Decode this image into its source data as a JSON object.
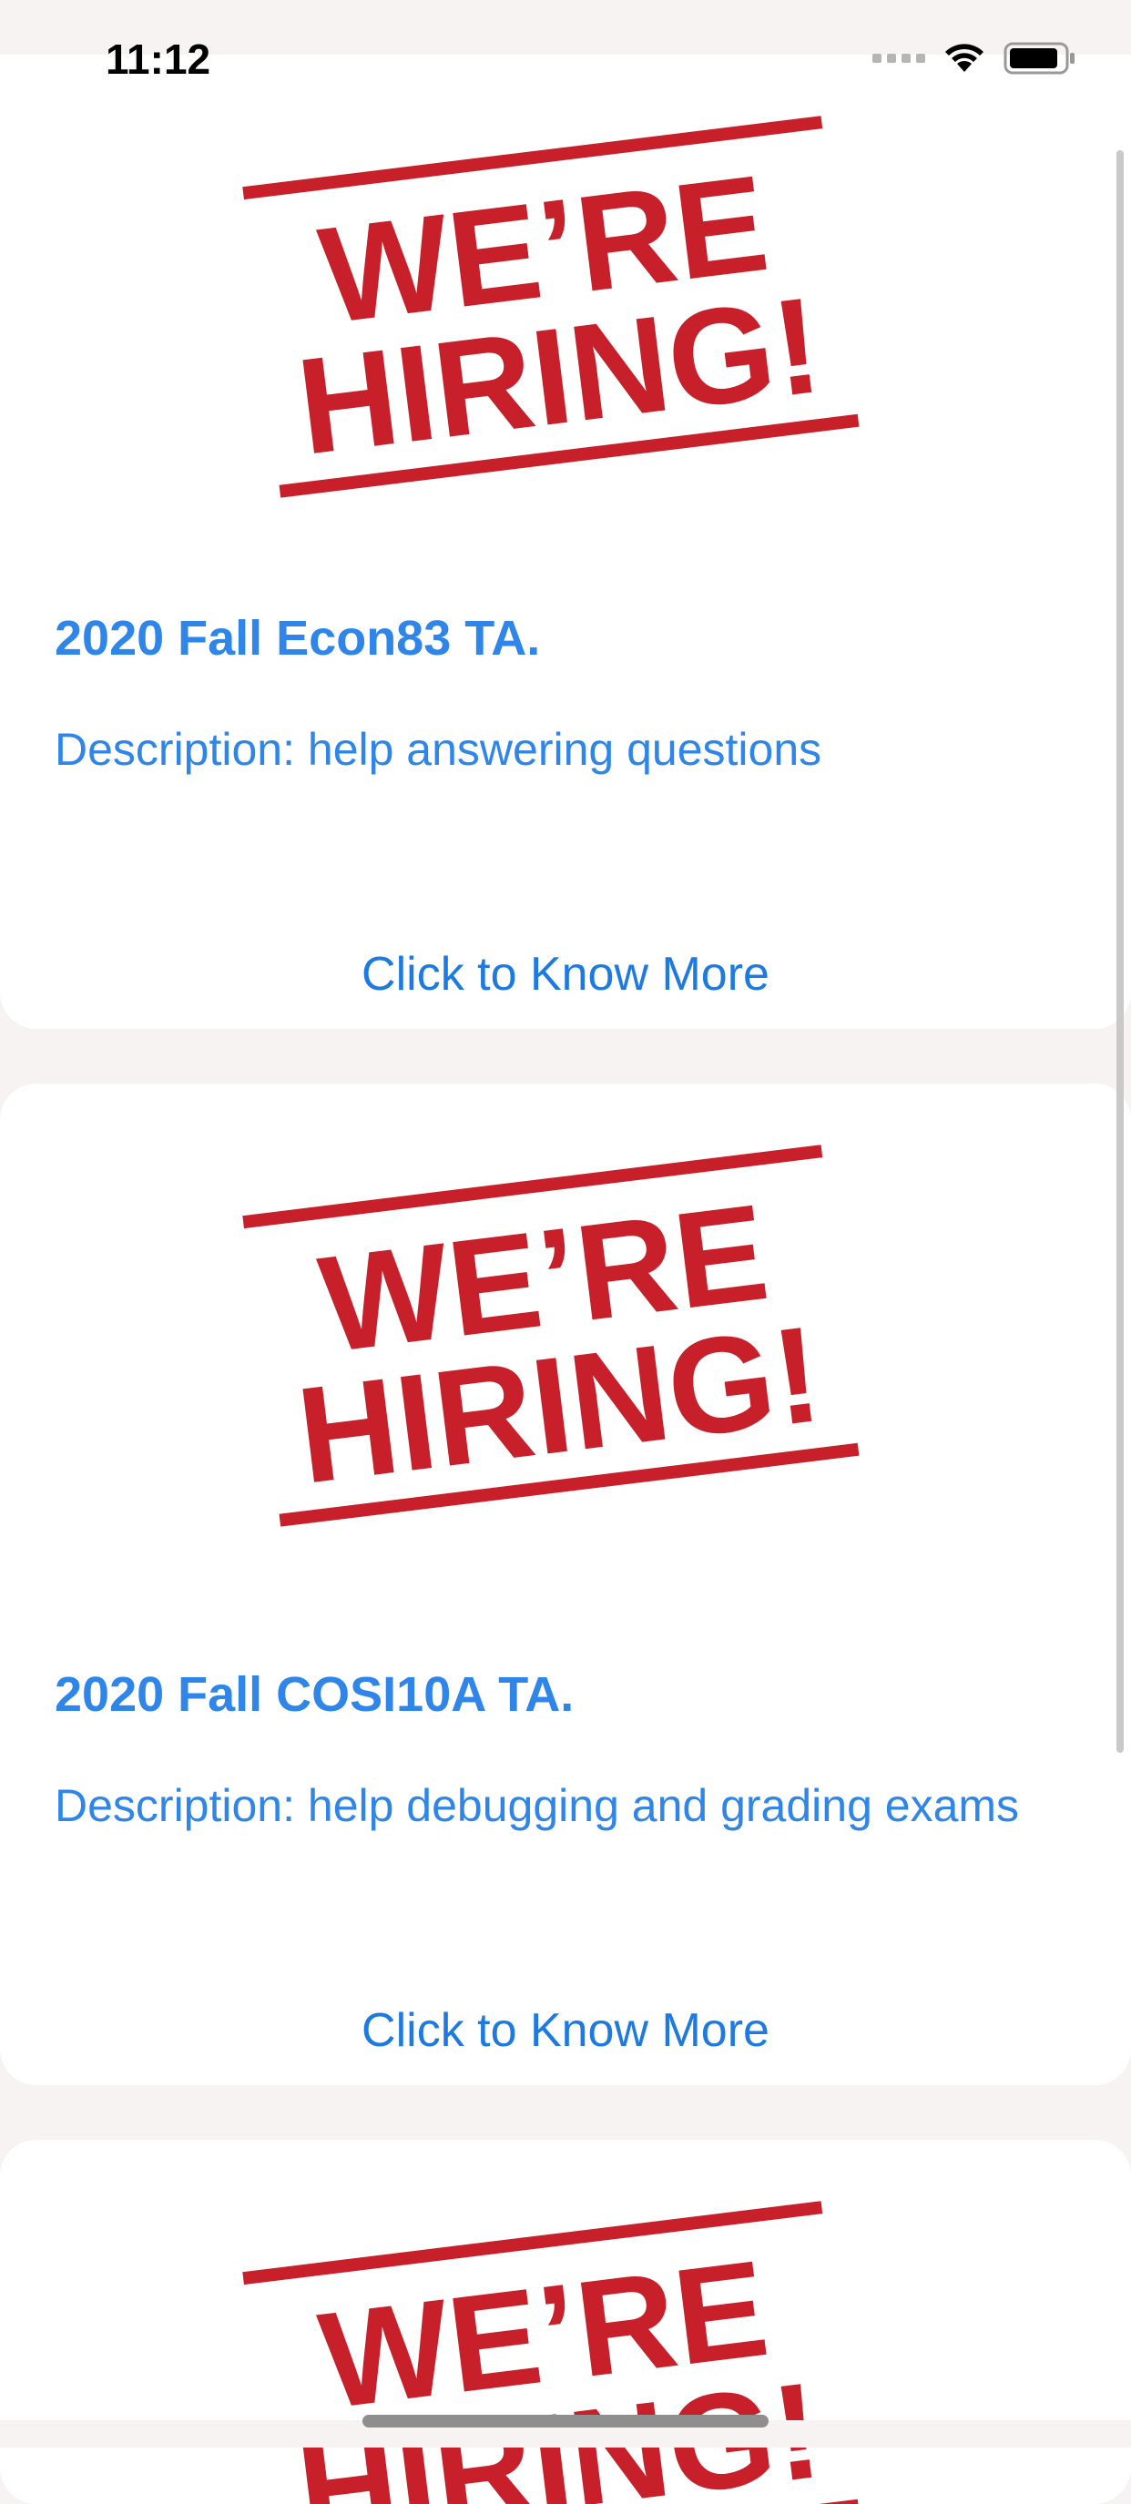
{
  "status_bar": {
    "time": "11:12"
  },
  "jobs": [
    {
      "image_icon": "hiring-stamp-image",
      "stamp_line_1": "WE’RE",
      "stamp_line_2": "HIRING!",
      "title": "2020 Fall Econ83 TA.",
      "description": "Description: help answering questions",
      "link_label": "Click to Know More"
    },
    {
      "image_icon": "hiring-stamp-image",
      "stamp_line_1": "WE’RE",
      "stamp_line_2": "HIRING!",
      "title": "2020 Fall COSI10A TA.",
      "description": "Description: help debugging and grading exams",
      "link_label": "Click to Know More"
    },
    {
      "image_icon": "hiring-stamp-image",
      "stamp_line_1": "WE’RE",
      "stamp_line_2": "HIRING!"
    }
  ],
  "colors": {
    "accent": "#2f86e8",
    "stamp_red": "#c8202b",
    "background": "#f6f3f2"
  }
}
